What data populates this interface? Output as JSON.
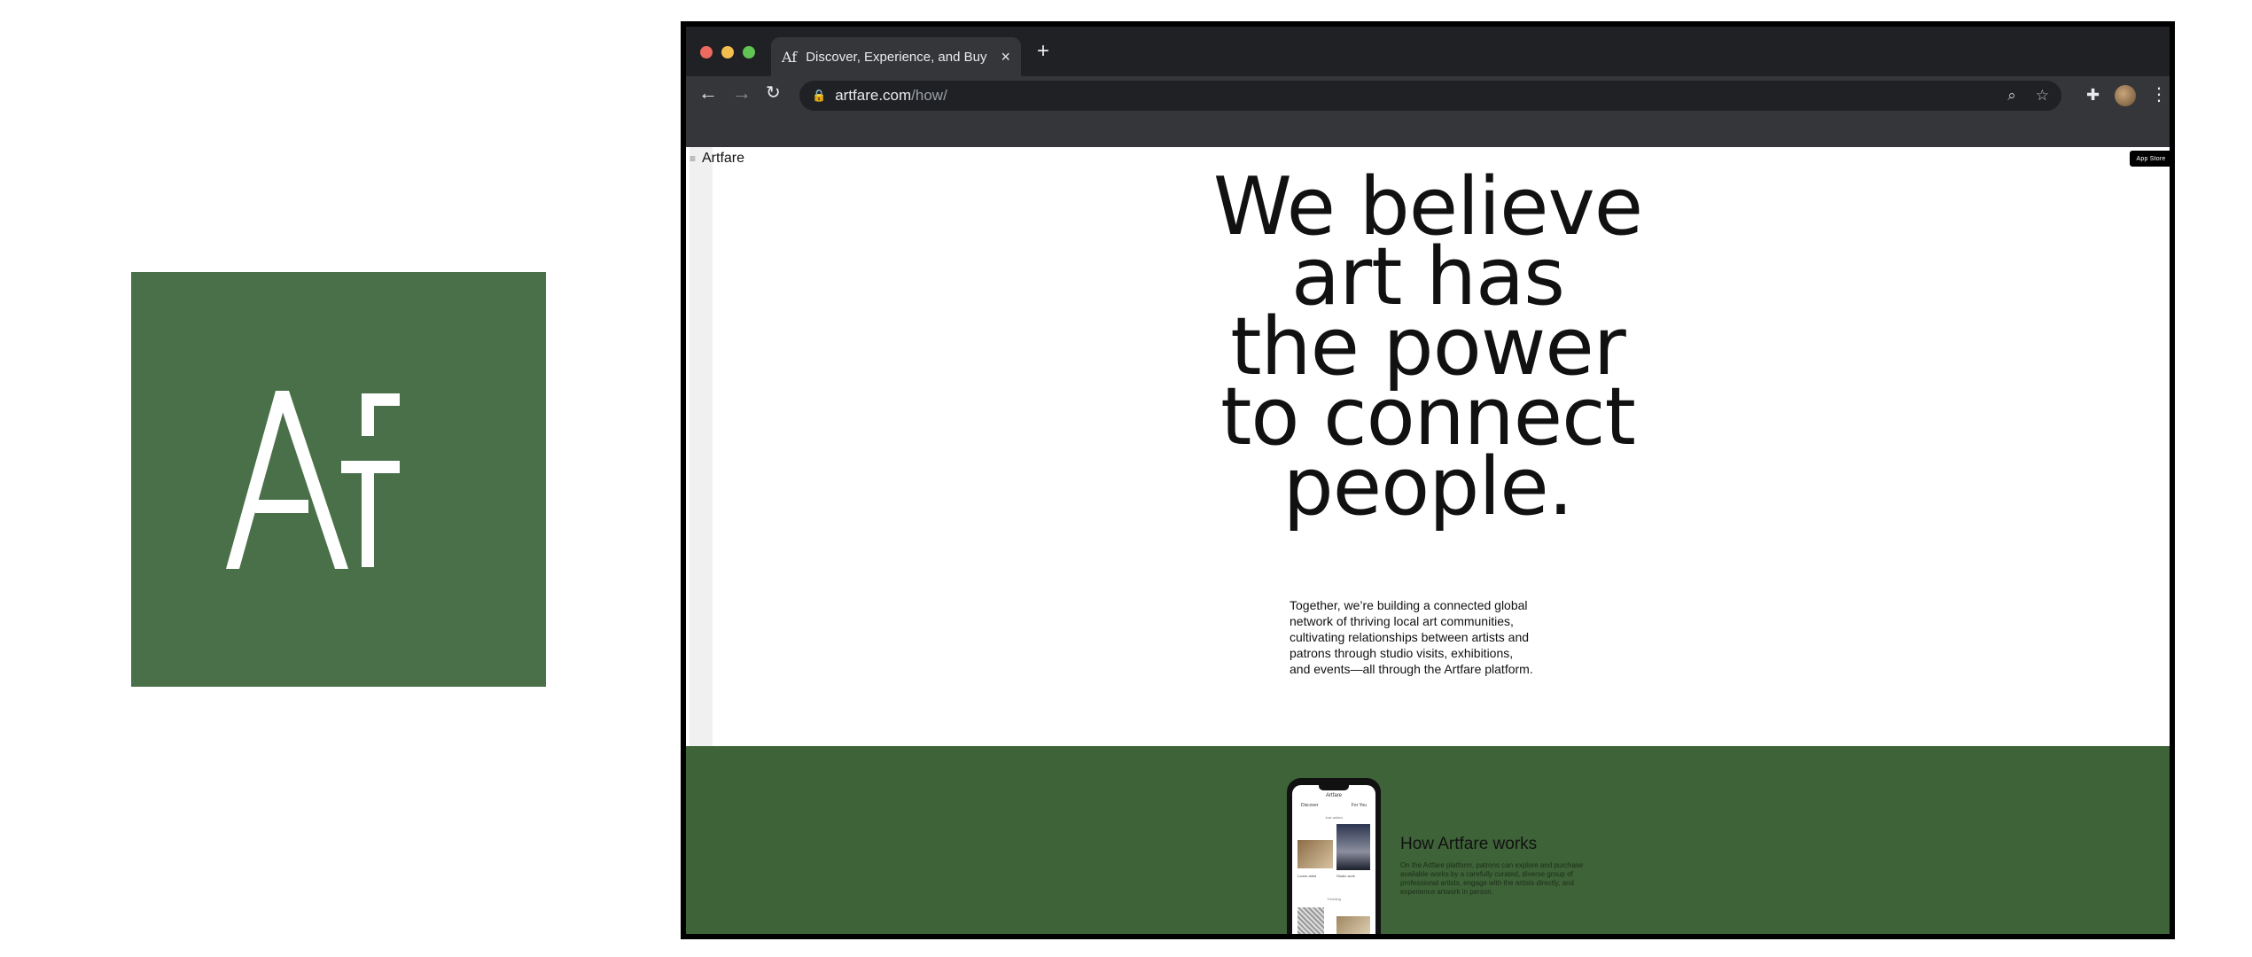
{
  "logo": {
    "mark": "Af",
    "tile_color": "#4a7049",
    "mark_color": "#ffffff"
  },
  "browser": {
    "tab_title": "Discover, Experience, and Buy",
    "tab_favicon": "Af",
    "new_tab_glyph": "+",
    "close_glyph": "×",
    "url_host": "artfare.com",
    "url_path": "/how/"
  },
  "page": {
    "brand": "Artfare",
    "app_store_label": "App Store",
    "headline_lines": [
      "We believe",
      "art has",
      "the power",
      "to connect",
      "people."
    ],
    "intro_lines": [
      "Together, we’re building a connected global",
      "network of thriving local art communities,",
      "cultivating relationships between artists and",
      "patrons through studio visits, exhibitions,",
      "and events—all through the Artfare platform."
    ],
    "phone": {
      "app_name": "Artfare",
      "tab_discover": "Discover",
      "tab_for_you": "For You",
      "section_1": "Just added",
      "section_2": "Trending",
      "caption_1": "Lorem artist",
      "caption_2": "Studio work"
    },
    "how_title": "How Artfare works",
    "how_text": "On the Artfare platform, patrons can explore and purchase available works by a carefully curated, diverse group of professional artists, engage with the artists directly, and experience artwork in person.",
    "band_color": "#3e6338"
  }
}
